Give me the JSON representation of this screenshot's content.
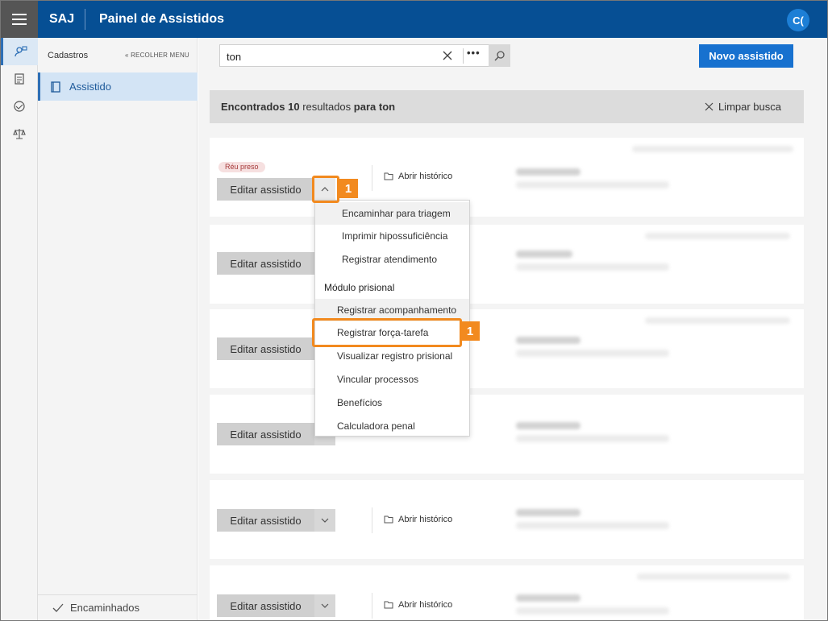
{
  "header": {
    "brand": "SAJ",
    "title": "Painel de Assistidos",
    "avatar": "C("
  },
  "rail": {
    "icons": [
      "person-search-icon",
      "clipboard-icon",
      "handshake-icon",
      "scales-icon"
    ]
  },
  "sidemenu": {
    "heading": "Cadastros",
    "collapse": "« RECOLHER MENU",
    "active_item": "Assistido",
    "footer_item": "Encaminhados"
  },
  "search": {
    "value": "ton",
    "more": "•••"
  },
  "toolbar": {
    "new_label": "Novo assistido"
  },
  "results": {
    "prefix": "Encontrados",
    "count": "10",
    "mid": "resultados",
    "suffix": "para ton",
    "clear_label": "Limpar busca"
  },
  "cards": {
    "edit_label": "Editar assistido",
    "history_label": "Abrir histórico",
    "badge": "Réu preso"
  },
  "dropdown": {
    "items_top": [
      "Encaminhar para triagem",
      "Imprimir hipossuficiência",
      "Registrar atendimento"
    ],
    "section": "Módulo prisional",
    "items_section": [
      "Registrar acompanhamento",
      "Registrar força-tarefa",
      "Visualizar registro prisional",
      "Vincular processos",
      "Benefícios",
      "Calculadora penal"
    ]
  },
  "callouts": [
    "1",
    "1"
  ],
  "colors": {
    "header": "#064f94",
    "primary": "#1771cf",
    "callout": "#f28a1f",
    "badge_text": "#a63a3a"
  }
}
